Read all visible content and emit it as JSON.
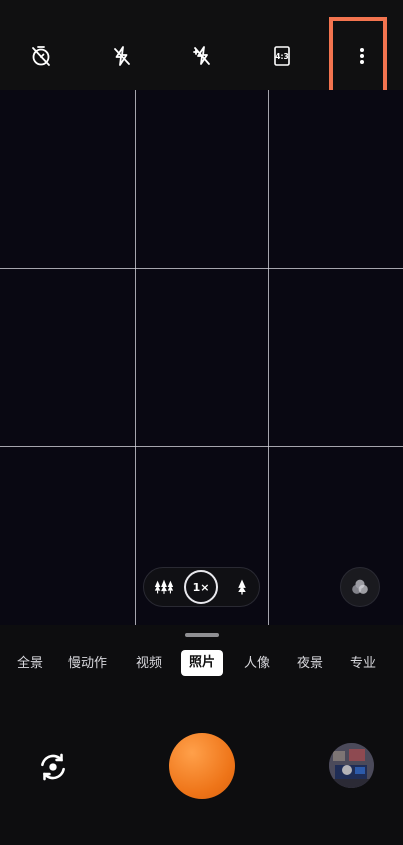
{
  "top_bar": {
    "icons": [
      "timer-off-icon",
      "flash-off-icon",
      "hdr-off-icon",
      "aspect-ratio-icon",
      "more-options-icon"
    ],
    "aspect_ratio_label": "4:3",
    "highlight_color": "#f3744f"
  },
  "viewfinder": {
    "background": "#090812",
    "grid": "3x3"
  },
  "zoom": {
    "current": "1×",
    "wide_icon": "multi-tree-icon",
    "tele_icon": "single-tree-icon"
  },
  "filter_icon": "color-filter-icon",
  "modes": {
    "items": [
      "全景",
      "慢动作",
      "视频",
      "照片",
      "人像",
      "夜景",
      "专业"
    ],
    "active": "照片"
  },
  "controls": {
    "switch_camera_icon": "switch-camera-icon",
    "shutter_color": "#ee7418",
    "gallery_thumbnail": "gallery-thumbnail"
  }
}
